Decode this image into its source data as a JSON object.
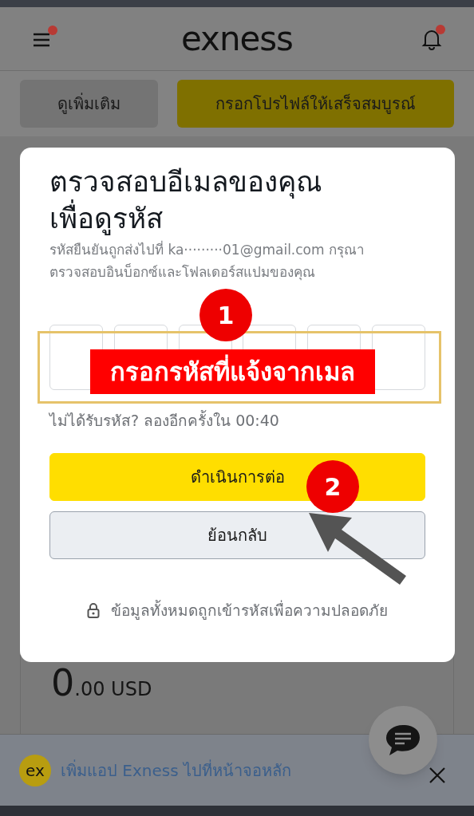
{
  "header": {
    "logo": "exness",
    "menu_badge": true,
    "bell_badge": true
  },
  "actions": [
    {
      "label": "ดูเพิ่มเติม",
      "kind": "secondary"
    },
    {
      "label": "กรอกโปรไฟล์ให้เสร็จสมบูรณ์",
      "kind": "primary"
    }
  ],
  "balance": {
    "integer": "0",
    "fraction": ".00 USD"
  },
  "install_banner": {
    "logo": "ex",
    "text": "เพิ่มแอป Exness ไปที่หน้าจอหลัก"
  },
  "modal": {
    "title_lines": [
      "ตรวจสอบอีเมลของคุณ",
      "เพื่อดูรหัส"
    ],
    "description_lines": [
      "รหัสยืนยันถูกส่งไปที่ ka·········01@gmail.com กรุณา",
      "ตรวจสอบอินบ็อกซ์และโฟลเดอร์สแปมของคุณ"
    ],
    "code_boxes": [
      {
        "filled": false
      },
      {
        "filled": false
      },
      {
        "filled": false
      },
      {
        "filled": false
      },
      {
        "filled": false
      },
      {
        "filled": false
      }
    ],
    "resend": "ไม่ได้รับรหัส? ลองอีกครั้งใน 00:40",
    "buttons": [
      {
        "label": "ดำเนินการต่อ",
        "kind": "primary"
      },
      {
        "label": "ย้อนกลับ",
        "kind": "secondary"
      }
    ],
    "security_note": "ข้อมูลทั้งหมดถูกเข้ารหัสเพื่อความปลอดภัย"
  },
  "annotations": {
    "code_label": "กรอกรหัสที่แจ้งจากเมล",
    "markers": [
      {
        "number": "1"
      },
      {
        "number": "2"
      }
    ]
  }
}
